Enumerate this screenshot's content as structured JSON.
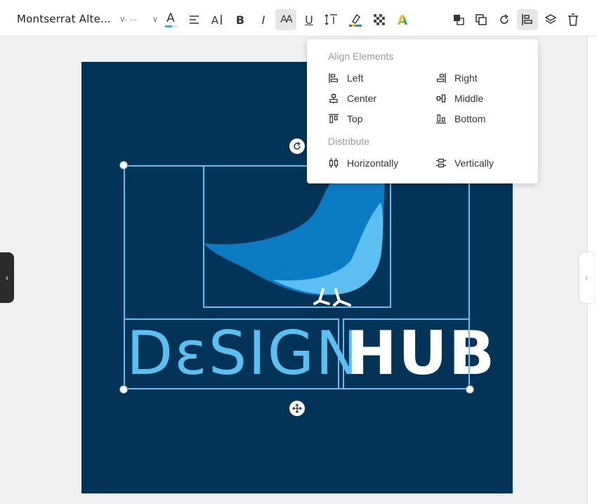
{
  "toolbar": {
    "font_name": "Montserrat Alte...",
    "font_size": "-- --",
    "font_color_letter": "A",
    "text_spacing_letter": "A",
    "bold_letter": "B",
    "italic_letter": "I",
    "all_caps_letters": "AA",
    "underline_letter": "U",
    "line_height_letter": "I",
    "gradient_letter": "A",
    "font_color_underline": "#3ab0e8"
  },
  "menu": {
    "align_heading": "Align Elements",
    "items": [
      {
        "label": "Left",
        "icon": "align-left-icon"
      },
      {
        "label": "Right",
        "icon": "align-right-icon"
      },
      {
        "label": "Center",
        "icon": "align-center-icon"
      },
      {
        "label": "Middle",
        "icon": "align-middle-icon"
      },
      {
        "label": "Top",
        "icon": "align-top-icon"
      },
      {
        "label": "Bottom",
        "icon": "align-bottom-icon"
      }
    ],
    "distribute_heading": "Distribute",
    "distribute_items": [
      {
        "label": "Horizontally",
        "icon": "distribute-horizontal-icon"
      },
      {
        "label": "Vertically",
        "icon": "distribute-vertical-icon"
      }
    ]
  },
  "canvas": {
    "background": "#033457",
    "word_design": "DεSIGN",
    "word_hub": "HUB",
    "selection_color": "#62c0f0",
    "bird_colors": [
      "#0b7cc4",
      "#5bbff2",
      "#ffffff"
    ]
  }
}
